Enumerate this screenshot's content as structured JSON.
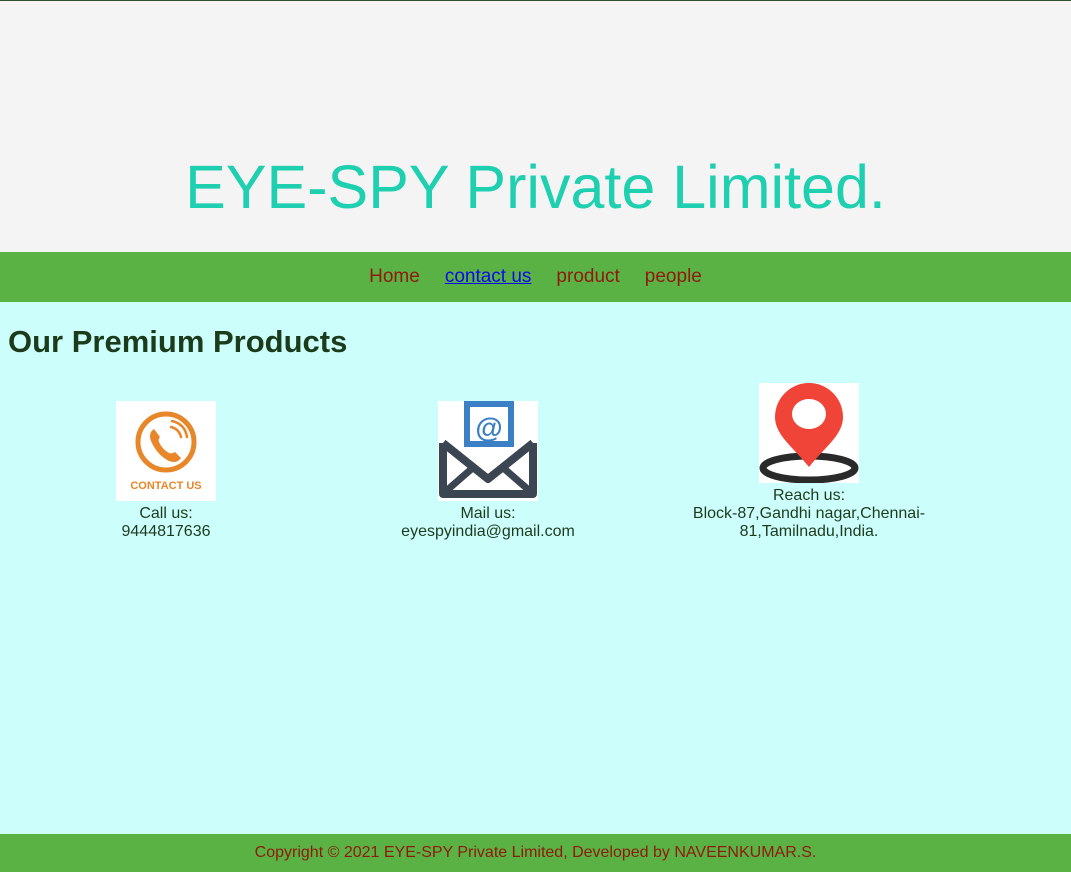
{
  "header": {
    "title": "EYE-SPY Private Limited."
  },
  "nav": {
    "items": [
      {
        "label": "Home",
        "active": false
      },
      {
        "label": "contact us",
        "active": true
      },
      {
        "label": "product",
        "active": false
      },
      {
        "label": "people",
        "active": false
      }
    ]
  },
  "main": {
    "heading": "Our Premium Products",
    "cards": [
      {
        "icon": "contact-us-phone-icon",
        "icon_text": "CONTACT US",
        "label": "Call us:",
        "value": "9444817636"
      },
      {
        "icon": "mail-icon",
        "label": "Mail us:",
        "value": "eyespyindia@gmail.com"
      },
      {
        "icon": "location-pin-icon",
        "label": "Reach us:",
        "value": "Block-87,Gandhi nagar,Chennai-81,Tamilnadu,India."
      }
    ]
  },
  "footer": {
    "text": "Copyright © 2021 EYE-SPY Private Limited, Developed by NAVEENKUMAR.S."
  },
  "colors": {
    "page_background": "#ccfffb",
    "header_background": "#f4f4f4",
    "title_color": "#1ecfb0",
    "nav_background": "#5ab244",
    "nav_link": "#8f1a0c",
    "nav_link_active": "#0a0aee",
    "heading_color": "#1b3b1b",
    "icon_orange": "#e8862a",
    "icon_blue": "#3b7fc4",
    "icon_dark": "#3b4652",
    "pin_red": "#f04438"
  }
}
